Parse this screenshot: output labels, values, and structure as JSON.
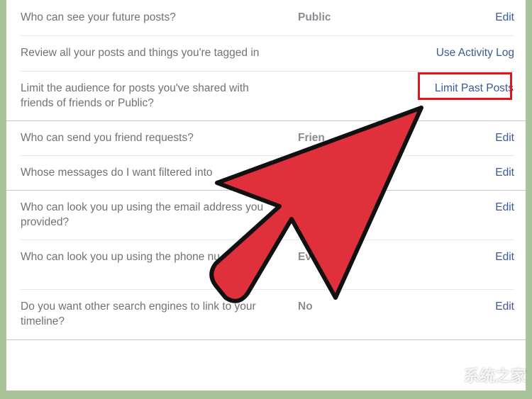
{
  "rows": [
    {
      "question": "Who can see your future posts?",
      "value": "Public",
      "action": "Edit"
    },
    {
      "question": "Review all your posts and things you're tagged in",
      "value": "",
      "action": "Use Activity Log"
    },
    {
      "question": "Limit the audience for posts you've shared with friends of friends or Public?",
      "value": "",
      "action": "Limit Past Posts"
    },
    {
      "question": "Who can send you friend requests?",
      "value": "Frien",
      "action": "Edit"
    },
    {
      "question": "Whose messages do I want filtered into",
      "value": "",
      "action": "Edit"
    },
    {
      "question": "Who can look you up using the email address you provided?",
      "value": "",
      "action": "Edit"
    },
    {
      "question": "Who can look you up using the phone nu provided?",
      "value": "Ev",
      "action": "Edit"
    },
    {
      "question": "Do you want other search engines to link to your timeline?",
      "value": "No",
      "action": "Edit"
    }
  ],
  "overlay": {
    "arrow_color": "#e0303c",
    "highlight_color": "#e0141d",
    "arrow_icon": "pointer-arrow-icon"
  },
  "watermark": {
    "text": "系统之家"
  },
  "colors": {
    "link": "#3b5998",
    "background": "#a9c49a"
  }
}
